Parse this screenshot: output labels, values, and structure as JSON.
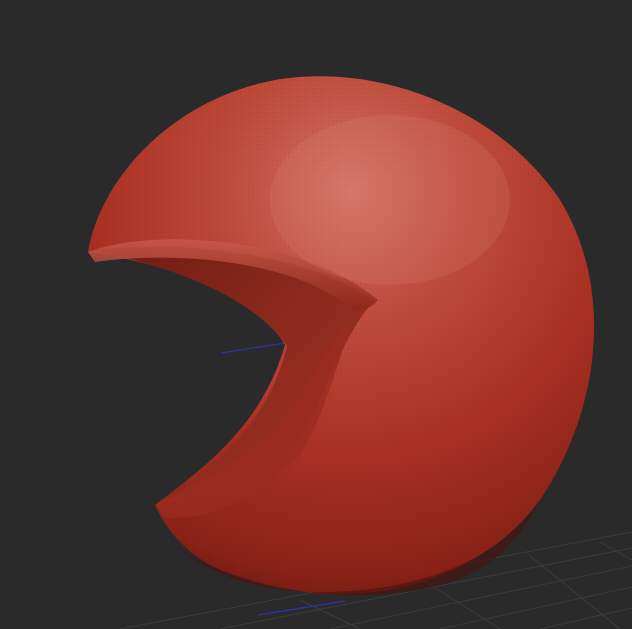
{
  "viewport": {
    "background_color": "#2a2a2a",
    "grid_color": "#3a3a3a",
    "axis_color": "#2f2fb0",
    "model": {
      "kind": "sculpted-sphere",
      "surface_color": "#b8372a",
      "highlight_color": "#d07062",
      "shadow_color": "#5a130c"
    }
  }
}
